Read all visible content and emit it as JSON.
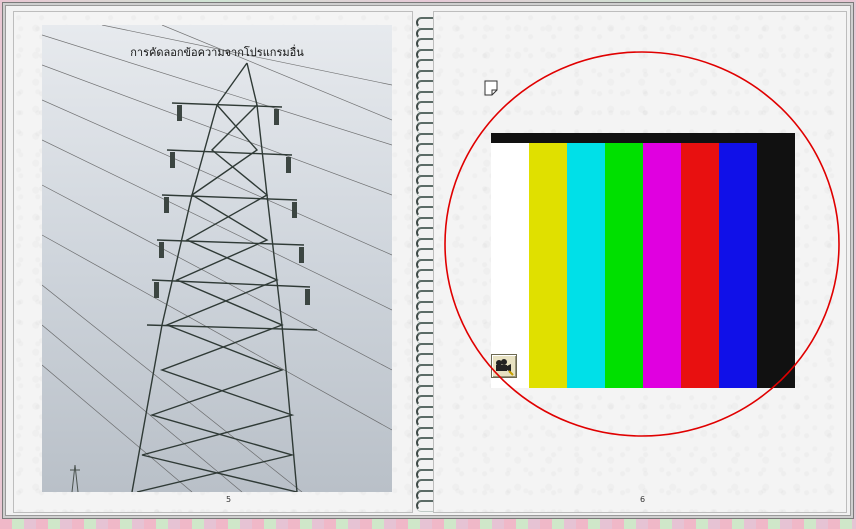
{
  "left_page": {
    "caption": "การคัดลอกข้อความจากโปรแกรมอื่น",
    "page_number": "5"
  },
  "right_page": {
    "page_number": "6"
  },
  "colors": {
    "color_bars": [
      "#ffffff",
      "#e0e000",
      "#00e0e8",
      "#00e000",
      "#e000e0",
      "#e81010",
      "#1010e8",
      "#111111"
    ],
    "annotation_ring": "#e00000"
  },
  "icons": {
    "note": "sticky-note-icon",
    "camera": "movie-camera-icon"
  }
}
